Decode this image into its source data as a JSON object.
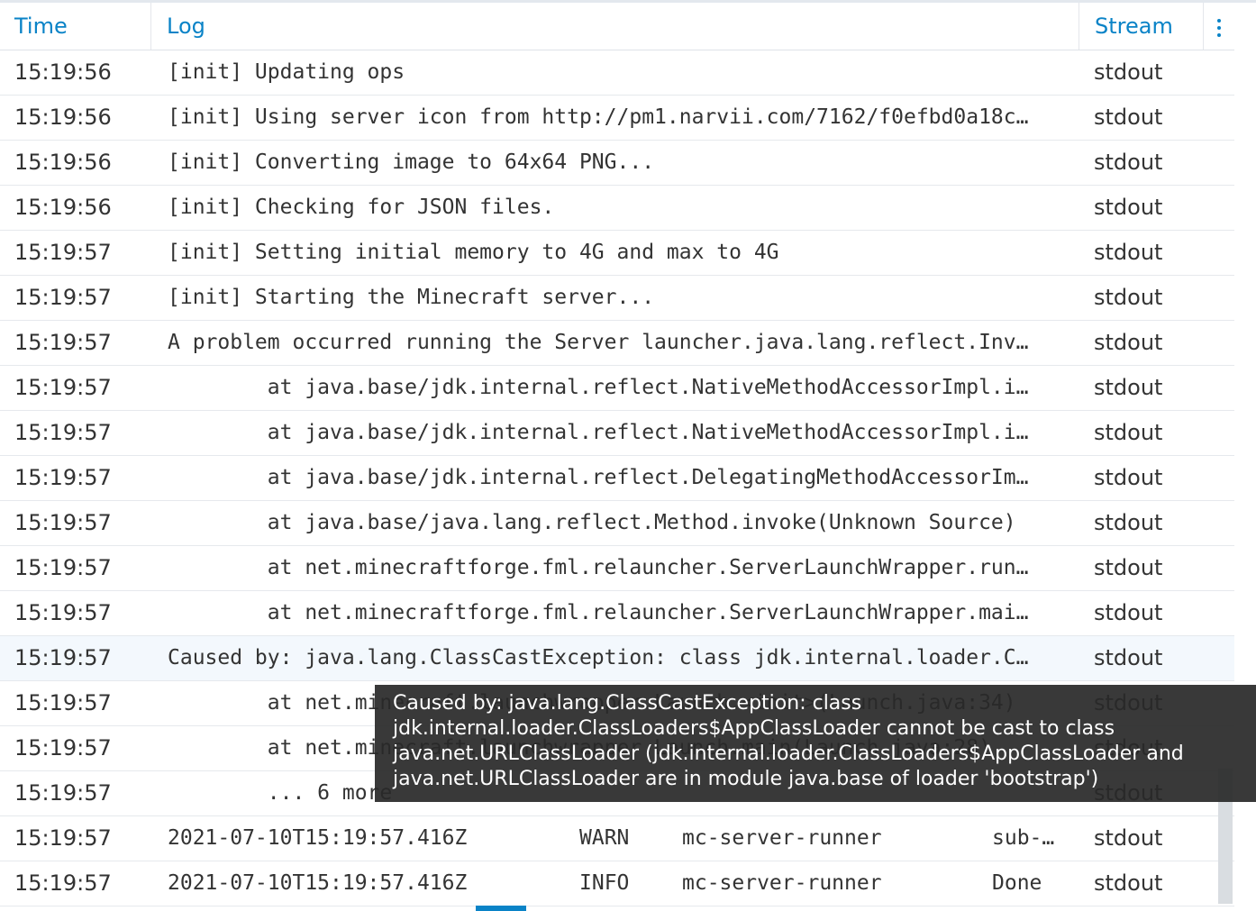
{
  "columns": {
    "time": "Time",
    "log": "Log",
    "stream": "Stream"
  },
  "rows": [
    {
      "time": "15:19:56",
      "log": "[init] Updating ops",
      "stream": "stdout"
    },
    {
      "time": "15:19:56",
      "log": "[init] Using server icon from http://pm1.narvii.com/7162/f0efbd0a18c…",
      "stream": "stdout"
    },
    {
      "time": "15:19:56",
      "log": "[init] Converting image to 64x64 PNG...",
      "stream": "stdout"
    },
    {
      "time": "15:19:56",
      "log": "[init] Checking for JSON files.",
      "stream": "stdout"
    },
    {
      "time": "15:19:57",
      "log": "[init] Setting initial memory to 4G and max to 4G",
      "stream": "stdout"
    },
    {
      "time": "15:19:57",
      "log": "[init] Starting the Minecraft server...",
      "stream": "stdout"
    },
    {
      "time": "15:19:57",
      "log": "A problem occurred running the Server launcher.java.lang.reflect.Inv…",
      "stream": "stdout"
    },
    {
      "time": "15:19:57",
      "log": "        at java.base/jdk.internal.reflect.NativeMethodAccessorImpl.i…",
      "stream": "stdout"
    },
    {
      "time": "15:19:57",
      "log": "        at java.base/jdk.internal.reflect.NativeMethodAccessorImpl.i…",
      "stream": "stdout"
    },
    {
      "time": "15:19:57",
      "log": "        at java.base/jdk.internal.reflect.DelegatingMethodAccessorIm…",
      "stream": "stdout"
    },
    {
      "time": "15:19:57",
      "log": "        at java.base/java.lang.reflect.Method.invoke(Unknown Source)",
      "stream": "stdout"
    },
    {
      "time": "15:19:57",
      "log": "        at net.minecraftforge.fml.relauncher.ServerLaunchWrapper.run…",
      "stream": "stdout"
    },
    {
      "time": "15:19:57",
      "log": "        at net.minecraftforge.fml.relauncher.ServerLaunchWrapper.mai…",
      "stream": "stdout"
    },
    {
      "time": "15:19:57",
      "log": "Caused by: java.lang.ClassCastException: class jdk.internal.loader.C…",
      "stream": "stdout"
    },
    {
      "time": "15:19:57",
      "log": "        at net.minecraft.launchwrapper.Launch.<init>(Launch.java:34)",
      "stream": "stdout"
    },
    {
      "time": "15:19:57",
      "log": "        at net.minecraft.launchwrapper.Launch.main(Launch.java:28)",
      "stream": "stdout"
    },
    {
      "time": "15:19:57",
      "log": "        ... 6 more",
      "stream": "stdout"
    }
  ],
  "structured_rows": [
    {
      "time": "15:19:57",
      "timestamp": "2021-07-10T15:19:57.416Z",
      "level": "WARN",
      "source": "mc-server-runner",
      "message": "sub-…",
      "stream": "stdout"
    },
    {
      "time": "15:19:57",
      "timestamp": "2021-07-10T15:19:57.416Z",
      "level": "INFO",
      "source": "mc-server-runner",
      "message": "Done",
      "stream": "stdout"
    }
  ],
  "tooltip": {
    "text": "Caused by: java.lang.ClassCastException: class jdk.internal.loader.ClassLoaders$AppClassLoader cannot be cast to class java.net.URLClassLoader (jdk.internal.loader.ClassLoaders$AppClassLoader and java.net.URLClassLoader are in module java.base of loader 'bootstrap')"
  }
}
